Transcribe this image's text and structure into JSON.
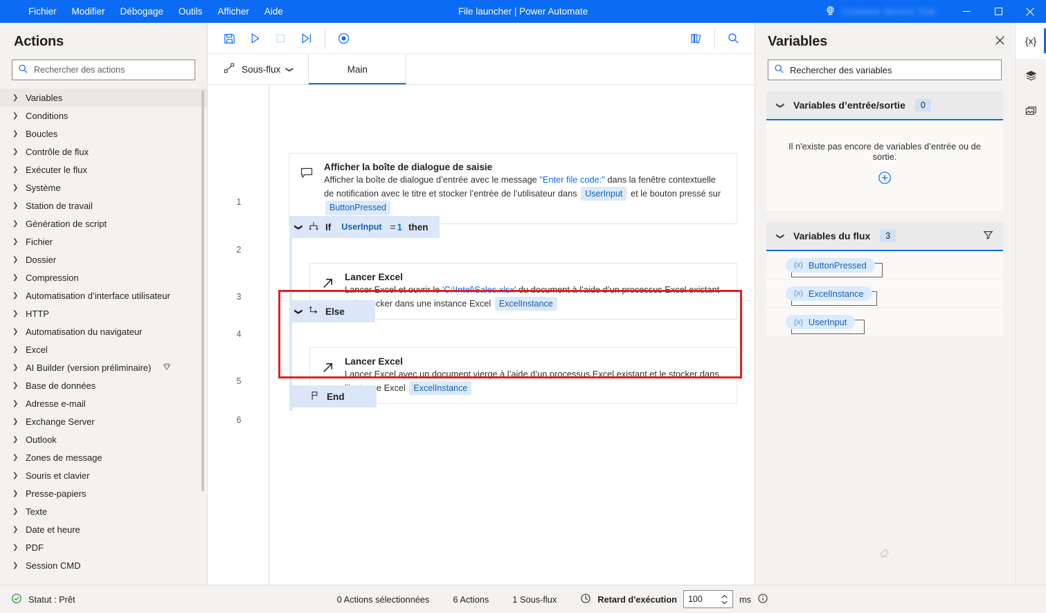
{
  "titlebar": {
    "menu": [
      "Fichier",
      "Modifier",
      "Débogage",
      "Outils",
      "Afficher",
      "Aide"
    ],
    "title": "File launcher | Power Automate",
    "tenant_name": "Customer Service Trial",
    "globe_icon": "globe-icon",
    "minimize": "—",
    "maximize": "▢",
    "close": "✕",
    "accent_color": "#0b6bf2"
  },
  "actions_panel": {
    "title": "Actions",
    "search": {
      "placeholder": "Rechercher des actions",
      "value": "",
      "icon": "search-icon"
    },
    "items": [
      {
        "label": "Variables",
        "selected": true,
        "premium": false
      },
      {
        "label": "Conditions",
        "selected": false,
        "premium": false
      },
      {
        "label": "Boucles",
        "selected": false,
        "premium": false
      },
      {
        "label": "Contrôle de flux",
        "selected": false,
        "premium": false
      },
      {
        "label": "Exécuter le flux",
        "selected": false,
        "premium": false
      },
      {
        "label": "Système",
        "selected": false,
        "premium": false
      },
      {
        "label": "Station de travail",
        "selected": false,
        "premium": false
      },
      {
        "label": "Génération de script",
        "selected": false,
        "premium": false
      },
      {
        "label": "Fichier",
        "selected": false,
        "premium": false
      },
      {
        "label": "Dossier",
        "selected": false,
        "premium": false
      },
      {
        "label": "Compression",
        "selected": false,
        "premium": false
      },
      {
        "label": "Automatisation d’interface utilisateur",
        "selected": false,
        "premium": false
      },
      {
        "label": "HTTP",
        "selected": false,
        "premium": false
      },
      {
        "label": "Automatisation du navigateur",
        "selected": false,
        "premium": false
      },
      {
        "label": "Excel",
        "selected": false,
        "premium": false
      },
      {
        "label": "AI Builder (version préliminaire)",
        "selected": false,
        "premium": true
      },
      {
        "label": "Base de données",
        "selected": false,
        "premium": false
      },
      {
        "label": "Adresse e-mail",
        "selected": false,
        "premium": false
      },
      {
        "label": "Exchange Server",
        "selected": false,
        "premium": false
      },
      {
        "label": "Outlook",
        "selected": false,
        "premium": false
      },
      {
        "label": "Zones de message",
        "selected": false,
        "premium": false
      },
      {
        "label": "Souris et clavier",
        "selected": false,
        "premium": false
      },
      {
        "label": "Presse-papiers",
        "selected": false,
        "premium": false
      },
      {
        "label": "Texte",
        "selected": false,
        "premium": false
      },
      {
        "label": "Date et heure",
        "selected": false,
        "premium": false
      },
      {
        "label": "PDF",
        "selected": false,
        "premium": false
      },
      {
        "label": "Session CMD",
        "selected": false,
        "premium": false
      }
    ]
  },
  "toolbar": {
    "buttons": [
      {
        "name": "save-button",
        "icon": "save-icon"
      },
      {
        "name": "run-button",
        "icon": "play-icon"
      },
      {
        "name": "stop-button",
        "icon": "stop-icon"
      },
      {
        "name": "run-next-action-button",
        "icon": "step-icon"
      },
      {
        "name": "recorder-button",
        "icon": "record-icon"
      }
    ],
    "right_buttons": [
      {
        "name": "ui-elements-button",
        "icon": "library-icon"
      },
      {
        "name": "find-button",
        "icon": "search-icon"
      }
    ]
  },
  "tabs": {
    "subflow": {
      "label": "Sous-flux",
      "icon": "subflow-icon",
      "chevron": "chevron-down-icon"
    },
    "main": {
      "label": "Main",
      "active": true
    }
  },
  "flow": {
    "steps": [
      {
        "number": "1",
        "kind": "card",
        "icon": "dialog-icon",
        "title": "Afficher la boîte de dialogue de saisie",
        "desc_parts": [
          {
            "t": "Afficher la boîte de dialogue d’entrée avec le message ",
            "style": "plain"
          },
          {
            "t": "\"Enter file code:\"",
            "style": "string"
          },
          {
            "t": " dans la fenêtre contextuelle de notification avec le titre  et stocker l’entrée de l’utilisateur dans ",
            "style": "plain"
          },
          {
            "t": "UserInput",
            "style": "pill"
          },
          {
            "t": " et le bouton pressé sur ",
            "style": "plain"
          },
          {
            "t": "ButtonPressed",
            "style": "pill"
          }
        ]
      },
      {
        "number": "2",
        "kind": "block",
        "icon": "if-icon",
        "chevron": "chevron-down-icon",
        "parts": [
          {
            "t": "If",
            "style": "bold"
          },
          {
            "t": "UserInput",
            "style": "pill"
          },
          {
            "t": "=",
            "style": "plain"
          },
          {
            "t": "1",
            "style": "string"
          },
          {
            "t": "then",
            "style": "bold"
          }
        ]
      },
      {
        "number": "3",
        "kind": "card",
        "icon": "launch-excel-icon",
        "title": "Lancer Excel",
        "desc_parts": [
          {
            "t": "Lancer Excel et ouvrir le ",
            "style": "plain"
          },
          {
            "t": "'C:\\Intel\\Sales.xlsx'",
            "style": "string"
          },
          {
            "t": " du document à l’aide d’un processus Excel existant et le stocker dans une instance Excel ",
            "style": "plain"
          },
          {
            "t": "ExcelInstance",
            "style": "pill"
          }
        ]
      },
      {
        "number": "4",
        "kind": "block",
        "icon": "else-icon",
        "chevron": "chevron-down-icon",
        "parts": [
          {
            "t": "Else",
            "style": "bold"
          }
        ]
      },
      {
        "number": "5",
        "kind": "card",
        "icon": "launch-excel-icon",
        "title": "Lancer Excel",
        "desc_parts": [
          {
            "t": "Lancer Excel avec un document vierge à l’aide d’un processus Excel existant et le stocker dans l'instance Excel ",
            "style": "plain"
          },
          {
            "t": "ExcelInstance",
            "style": "pill"
          }
        ]
      },
      {
        "number": "6",
        "kind": "block",
        "icon": "end-flag-icon",
        "parts": [
          {
            "t": "End",
            "style": "bold"
          }
        ]
      }
    ],
    "highlight": {
      "color": "#e02020",
      "covers": "else-branch"
    }
  },
  "variables_panel": {
    "title": "Variables",
    "close_icon": "close-icon",
    "search": {
      "placeholder": "Rechercher des variables",
      "value": "",
      "icon": "search-icon"
    },
    "io_group": {
      "label": "Variables d’entrée/sortie",
      "count": "0",
      "chevron": "chevron-down-icon",
      "empty_message": "Il n'existe pas encore de variables d’entrée ou de sortie.",
      "add_icon": "plus-circle-icon"
    },
    "flow_group": {
      "label": "Variables du flux",
      "count": "3",
      "chevron": "chevron-down-icon",
      "filter_icon": "filter-icon",
      "variables": [
        {
          "name": "ButtonPressed",
          "marker": "(x)"
        },
        {
          "name": "ExcelInstance",
          "marker": "(x)"
        },
        {
          "name": "UserInput",
          "marker": "(x)"
        }
      ]
    },
    "eraser_icon": "eraser-icon"
  },
  "rail": [
    {
      "name": "variables-rail-button",
      "icon": "braces-icon",
      "glyph": "{x}",
      "active": true
    },
    {
      "name": "ui-elements-rail-button",
      "icon": "layers-icon",
      "active": false
    },
    {
      "name": "images-rail-button",
      "icon": "image-icon",
      "active": false
    }
  ],
  "statusbar": {
    "status_icon": "check-circle-icon",
    "status": "Statut : Prêt",
    "selected_actions": "0 Actions sélectionnées",
    "actions_count": "6 Actions",
    "subflows_count": "1 Sous-flux",
    "delay_icon": "clock-icon",
    "delay_label": "Retard d'exécution",
    "delay_value": "100",
    "delay_unit": "ms",
    "info_icon": "info-icon"
  }
}
